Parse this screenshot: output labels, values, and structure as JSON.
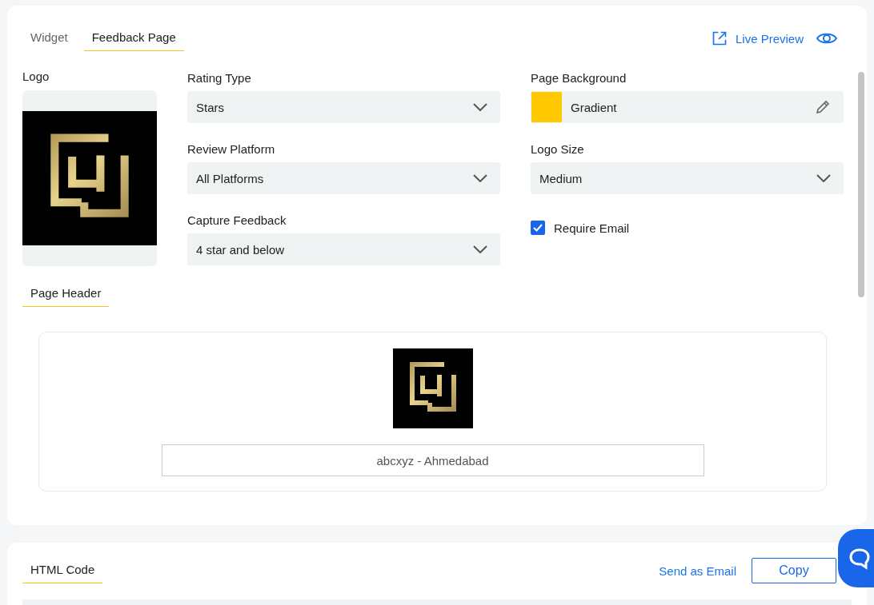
{
  "tabs": [
    {
      "label": "Widget",
      "selected": false
    },
    {
      "label": "Feedback Page",
      "selected": true
    }
  ],
  "live_preview": "Live Preview",
  "logo": {
    "label": "Logo"
  },
  "settings": [
    {
      "kind": "select",
      "label": "Rating Type",
      "value": "Stars"
    },
    {
      "kind": "color",
      "label": "Page Background",
      "value": "Gradient",
      "color": "#ffc800"
    },
    {
      "kind": "select",
      "label": "Review Platform",
      "value": "All Platforms"
    },
    {
      "kind": "select",
      "label": "Logo Size",
      "value": "Medium"
    },
    {
      "kind": "select",
      "label": "Capture Feedback",
      "value": "4 star and below"
    },
    {
      "kind": "checkbox",
      "label": "Require Email",
      "checked": true
    }
  ],
  "page_header": {
    "tab": "Page Header",
    "business_name": "abcxyz - Ahmedabad"
  },
  "html_code": {
    "tab": "HTML Code",
    "send_email": "Send as Email",
    "copy": "Copy"
  }
}
